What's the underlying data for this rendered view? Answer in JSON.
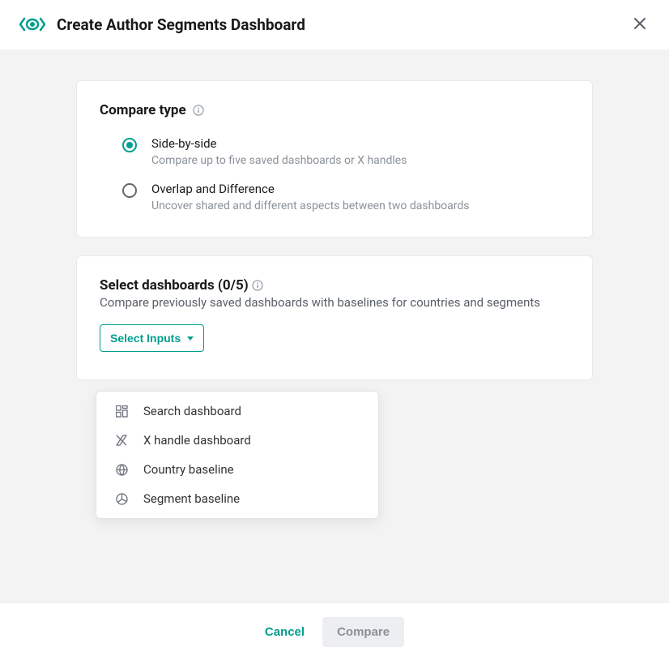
{
  "header": {
    "title": "Create Author Segments Dashboard"
  },
  "compare": {
    "title": "Compare type",
    "options": [
      {
        "label": "Side-by-side",
        "desc": "Compare up to five saved dashboards or X handles",
        "selected": true
      },
      {
        "label": "Overlap and Difference",
        "desc": "Uncover shared and different aspects between two dashboards",
        "selected": false
      }
    ]
  },
  "select": {
    "title": "Select dashboards (0/5)",
    "desc": "Compare previously saved dashboards with baselines for countries and segments",
    "button": "Select Inputs"
  },
  "dropdown": {
    "items": [
      {
        "icon": "dashboard-icon",
        "label": "Search dashboard"
      },
      {
        "icon": "x-icon",
        "label": "X handle dashboard"
      },
      {
        "icon": "globe-icon",
        "label": "Country baseline"
      },
      {
        "icon": "segment-icon",
        "label": "Segment baseline"
      }
    ]
  },
  "footer": {
    "cancel": "Cancel",
    "compare": "Compare"
  },
  "colors": {
    "accent": "#009e8f"
  }
}
